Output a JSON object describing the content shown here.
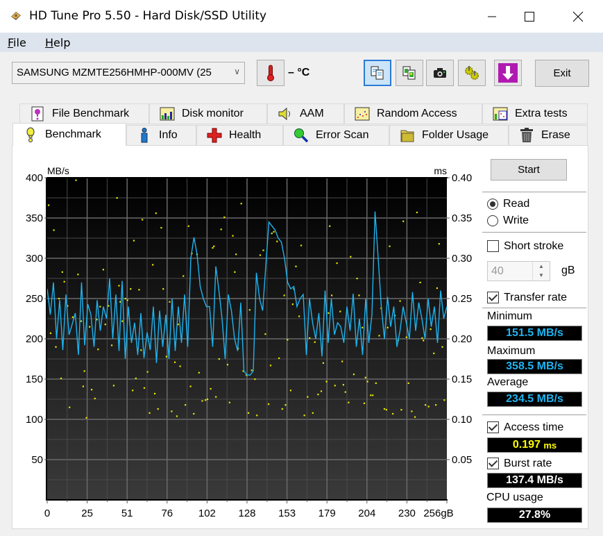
{
  "window": {
    "title": "HD Tune Pro 5.50 - Hard Disk/SSD Utility",
    "controls": [
      "minimize",
      "maximize",
      "close"
    ]
  },
  "menu": [
    {
      "label": "File",
      "accel": "F",
      "rest": "ile"
    },
    {
      "label": "Help",
      "accel": "H",
      "rest": "elp"
    }
  ],
  "toolbar": {
    "drive": "SAMSUNG MZMTE256HMHP-000MV (25",
    "temperature": "– °C",
    "buttons": [
      {
        "name": "copy-text-icon",
        "active": true
      },
      {
        "name": "copy-screenshot-icon",
        "active": false
      },
      {
        "name": "camera-icon",
        "active": false
      },
      {
        "name": "options-gears-icon",
        "active": false
      },
      {
        "name": "save-download-icon",
        "active": false
      }
    ],
    "exit_label": "Exit"
  },
  "tabs": {
    "top_row": [
      {
        "label": "File Benchmark",
        "icon": "file-benchmark-icon"
      },
      {
        "label": "Disk monitor",
        "icon": "disk-monitor-icon"
      },
      {
        "label": "AAM",
        "icon": "speaker-icon"
      },
      {
        "label": "Random Access",
        "icon": "random-access-icon"
      },
      {
        "label": "Extra tests",
        "icon": "extra-tests-icon"
      }
    ],
    "bottom_row": [
      {
        "label": "Benchmark",
        "icon": "exclamation-icon",
        "selected": true
      },
      {
        "label": "Info",
        "icon": "info-icon"
      },
      {
        "label": "Health",
        "icon": "health-cross-icon"
      },
      {
        "label": "Error Scan",
        "icon": "magnifier-icon"
      },
      {
        "label": "Folder Usage",
        "icon": "folder-icon"
      },
      {
        "label": "Erase",
        "icon": "trash-icon"
      }
    ]
  },
  "side": {
    "start_label": "Start",
    "read_label": "Read",
    "write_label": "Write",
    "mode": "Read",
    "short_stroke_label": "Short stroke",
    "short_stroke_checked": false,
    "short_stroke_value": "40",
    "short_stroke_unit": "gB",
    "transfer_rate_label": "Transfer rate",
    "transfer_rate_checked": true,
    "minimum_label": "Minimum",
    "minimum_value": "151.5 MB/s",
    "maximum_label": "Maximum",
    "maximum_value": "358.5 MB/s",
    "average_label": "Average",
    "average_value": "234.5 MB/s",
    "access_time_label": "Access time",
    "access_time_checked": true,
    "access_time_value": "0.197",
    "access_time_unit": "ms",
    "burst_rate_label": "Burst rate",
    "burst_rate_checked": true,
    "burst_rate_value": "137.4 MB/s",
    "cpu_label": "CPU usage",
    "cpu_value": "27.8%"
  },
  "colors": {
    "transfer_line": "#1eb4f0",
    "access_dots": "#e8e800",
    "lcd_blue": "#1eb4f0",
    "lcd_yellow": "#ffff00",
    "lcd_white": "#ffffff"
  },
  "chart_data": {
    "type": "line",
    "title": "",
    "xlabel": "gB",
    "ylabel": "MB/s",
    "y2label": "ms",
    "xlim": [
      0,
      256
    ],
    "ylim": [
      0,
      400
    ],
    "y2lim": [
      0,
      0.4
    ],
    "x_ticks": [
      "0",
      "25",
      "51",
      "76",
      "102",
      "128",
      "153",
      "179",
      "204",
      "230",
      "256gB"
    ],
    "y_ticks": [
      "400",
      "350",
      "300",
      "250",
      "200",
      "150",
      "100",
      "50"
    ],
    "y2_ticks": [
      "0.40",
      "0.35",
      "0.30",
      "0.25",
      "0.20",
      "0.15",
      "0.10",
      "0.05"
    ],
    "grid": true,
    "series": [
      {
        "name": "Transfer rate",
        "unit": "MB/s",
        "x": [
          0,
          2,
          4,
          6,
          8,
          10,
          12,
          14,
          16,
          18,
          20,
          22,
          24,
          26,
          28,
          30,
          32,
          34,
          36,
          38,
          40,
          42,
          44,
          46,
          48,
          50,
          52,
          54,
          56,
          58,
          60,
          62,
          64,
          66,
          68,
          70,
          72,
          74,
          76,
          78,
          80,
          82,
          84,
          86,
          88,
          90,
          92,
          94,
          96,
          98,
          100,
          102,
          104,
          106,
          108,
          110,
          112,
          114,
          116,
          118,
          120,
          122,
          124,
          126,
          128,
          130,
          132,
          134,
          136,
          138,
          140,
          142,
          144,
          146,
          148,
          150,
          152,
          154,
          156,
          158,
          160,
          162,
          164,
          166,
          168,
          170,
          172,
          174,
          176,
          178,
          180,
          182,
          184,
          186,
          188,
          190,
          192,
          194,
          196,
          198,
          200,
          202,
          204,
          206,
          208,
          210,
          212,
          214,
          216,
          218,
          220,
          222,
          224,
          226,
          228,
          230,
          232,
          234,
          236,
          238,
          240,
          242,
          244,
          246,
          248,
          250,
          252,
          254,
          256
        ],
        "values": [
          262,
          230,
          270,
          200,
          248,
          186,
          255,
          205,
          218,
          232,
          180,
          270,
          192,
          243,
          230,
          190,
          248,
          210,
          240,
          225,
          275,
          200,
          255,
          185,
          272,
          175,
          240,
          195,
          220,
          180,
          232,
          176,
          208,
          186,
          240,
          170,
          235,
          190,
          230,
          175,
          250,
          185,
          240,
          195,
          255,
          190,
          300,
          326,
          305,
          265,
          250,
          240,
          240,
          190,
          290,
          260,
          225,
          175,
          255,
          235,
          200,
          185,
          245,
          160,
          155,
          155,
          160,
          282,
          250,
          235,
          290,
          345,
          340,
          335,
          325,
          320,
          300,
          270,
          262,
          265,
          240,
          250,
          255,
          180,
          250,
          220,
          200,
          232,
          178,
          260,
          195,
          250,
          205,
          220,
          215,
          195,
          240,
          210,
          256,
          190,
          225,
          180,
          250,
          195,
          230,
          358,
          300,
          240,
          200,
          252,
          215,
          240,
          190,
          210,
          240,
          220,
          200,
          258,
          210,
          245,
          225,
          200,
          250,
          215,
          240,
          195,
          260,
          225,
          240
        ]
      },
      {
        "name": "Access time",
        "unit": "ms",
        "type": "scatter",
        "values": [
          0.366,
          0.262,
          0.348,
          0.214,
          0.305,
          0.16,
          0.34,
          0.218,
          0.198,
          0.331,
          0.246,
          0.152,
          0.315,
          0.283,
          0.128,
          0.356,
          0.112,
          0.236,
          0.187,
          0.143,
          0.306,
          0.263,
          0.118,
          0.322,
          0.204,
          0.168,
          0.397,
          0.135,
          0.246,
          0.103,
          0.31,
          0.192,
          0.275,
          0.124,
          0.335,
          0.228,
          0.159,
          0.107,
          0.368,
          0.215,
          0.142,
          0.278,
          0.116,
          0.321,
          0.25,
          0.13,
          0.175,
          0.241,
          0.108,
          0.338,
          0.202,
          0.15,
          0.286,
          0.121,
          0.305,
          0.19,
          0.136,
          0.261,
          0.113,
          0.328,
          0.222,
          0.147,
          0.171,
          0.27,
          0.119,
          0.375,
          0.214,
          0.138,
          0.25,
          0.105,
          0.292,
          0.198,
          0.155,
          0.126,
          0.234,
          0.34,
          0.182,
          0.113,
          0.262,
          0.145,
          0.351,
          0.227,
          0.131,
          0.178,
          0.11,
          0.304,
          0.241,
          0.156,
          0.123,
          0.207,
          0.29,
          0.139,
          0.315,
          0.188,
          0.102,
          0.254,
          0.166,
          0.118,
          0.333,
          0.222,
          0.147,
          0.128,
          0.271,
          0.201,
          0.113,
          0.346,
          0.161,
          0.24,
          0.134,
          0.107,
          0.318,
          0.199,
          0.151,
          0.238,
          0.121,
          0.28,
          0.17,
          0.11,
          0.357,
          0.206,
          0.142,
          0.254,
          0.125,
          0.19,
          0.316,
          0.108,
          0.229,
          0.16,
          0.137,
          0.294,
          0.118,
          0.212,
          0.176,
          0.248,
          0.13,
          0.336,
          0.115,
          0.196,
          0.262,
          0.145,
          0.105,
          0.218,
          0.302,
          0.158,
          0.124,
          0.243,
          0.186,
          0.112,
          0.283,
          0.141,
          0.232,
          0.104,
          0.201,
          0.167,
          0.266,
          0.12,
          0.313,
          0.151,
          0.189,
          0.132,
          0.247,
          0.108,
          0.224,
          0.172,
          0.141,
          0.118,
          0.254,
          0.136
        ]
      }
    ]
  }
}
